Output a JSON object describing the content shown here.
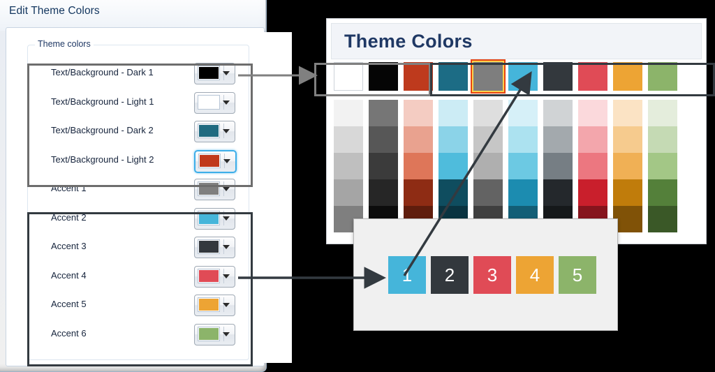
{
  "dialog": {
    "title": "Edit Theme Colors",
    "group_label": "Theme colors",
    "rows": [
      {
        "label_pre": "",
        "label": "Text/Background - Dark 1",
        "swatch": "#000000",
        "selected": false
      },
      {
        "label_pre": "",
        "label": "Text/Background - Light 1",
        "swatch": "#FFFFFF",
        "selected": false
      },
      {
        "label_pre": "",
        "label": "Text/Background - Dark 2",
        "swatch": "#1F6A80",
        "selected": false
      },
      {
        "label_pre": "",
        "label": "Text/Background - Light 2",
        "swatch": "#C0391B",
        "selected": true
      },
      {
        "label_pre": "",
        "label": "Accent 1",
        "swatch": "#7F7F7F",
        "selected": false
      },
      {
        "label_pre": "",
        "label": "Accent 2",
        "swatch": "#45B5DA",
        "selected": false
      },
      {
        "label_pre": "",
        "label": "Accent 3",
        "swatch": "#33383D",
        "selected": false
      },
      {
        "label_pre": "",
        "label": "Accent 4",
        "swatch": "#E04B56",
        "selected": false
      },
      {
        "label_pre": "",
        "label": "Accent 5",
        "swatch": "#EDA434",
        "selected": false
      },
      {
        "label_pre": "",
        "label": "Accent 6",
        "swatch": "#8CB46A",
        "selected": false
      }
    ],
    "highlight_groups": [
      {
        "name": "text-background-group",
        "rows": "1-4"
      },
      {
        "name": "accent-2-to-6-group",
        "rows": "6-10"
      }
    ]
  },
  "theme_panel": {
    "heading": "Theme Colors",
    "main_swatches": [
      {
        "name": "white",
        "color": "#FFFFFF",
        "outline": true,
        "highlighted": false
      },
      {
        "name": "black",
        "color": "#050505",
        "outline": false,
        "highlighted": false
      },
      {
        "name": "dark-red",
        "color": "#BE3A1D",
        "outline": false,
        "highlighted": false
      },
      {
        "name": "teal",
        "color": "#1C6C85",
        "outline": false,
        "highlighted": false
      },
      {
        "name": "gray",
        "color": "#7E7E7E",
        "outline": false,
        "highlighted": true
      },
      {
        "name": "light-blue",
        "color": "#45B5DA",
        "outline": false,
        "highlighted": false
      },
      {
        "name": "dark-slate",
        "color": "#33383D",
        "outline": false,
        "highlighted": false
      },
      {
        "name": "red",
        "color": "#E04B56",
        "outline": false,
        "highlighted": false
      },
      {
        "name": "orange",
        "color": "#EDA434",
        "outline": false,
        "highlighted": false
      },
      {
        "name": "green",
        "color": "#8CB46A",
        "outline": false,
        "highlighted": false
      }
    ],
    "tint_columns": [
      [
        "#F2F2F2",
        "#D8D8D8",
        "#BFBFBF",
        "#A5A5A5",
        "#7F7F7F"
      ],
      [
        "#767676",
        "#575757",
        "#3B3B3B",
        "#262626",
        "#0C0C0C"
      ],
      [
        "#F4CCC2",
        "#E9A28F",
        "#DE7659",
        "#8E2C14",
        "#5F1D0D"
      ],
      [
        "#CCECF5",
        "#8BD3E8",
        "#4FBCDC",
        "#0F4D5F",
        "#0A3340"
      ],
      [
        "#DEDEDE",
        "#C6C6C6",
        "#AFAFAF",
        "#636363",
        "#3F3F3F"
      ],
      [
        "#D6F0F8",
        "#ACE2F0",
        "#6CC9E3",
        "#1C8CB0",
        "#135E76"
      ],
      [
        "#D0D3D5",
        "#A3A9AD",
        "#767E84",
        "#24282C",
        "#15181A"
      ],
      [
        "#FBD9DC",
        "#F3A6AC",
        "#EC7780",
        "#C91F2C",
        "#86141D"
      ],
      [
        "#FBE3C4",
        "#F6CB8E",
        "#F0B055",
        "#C07C0B",
        "#805207"
      ],
      [
        "#E4EDDC",
        "#C5DAB4",
        "#A3C786",
        "#54803A",
        "#3A5827"
      ]
    ],
    "callouts": [
      {
        "name": "text-background-callout",
        "span": "swatches 1-4"
      },
      {
        "name": "accent-callout",
        "span": "swatches 5-10"
      }
    ]
  },
  "number_popup": {
    "boxes": [
      {
        "number": "1",
        "color": "#45B5DA"
      },
      {
        "number": "2",
        "color": "#33383D"
      },
      {
        "number": "3",
        "color": "#E04B56"
      },
      {
        "number": "4",
        "color": "#EDA434"
      },
      {
        "number": "5",
        "color": "#8CB46A"
      }
    ]
  },
  "annotations": {
    "arrow_light_color": "#808080",
    "arrow_dark_color": "#333a40"
  }
}
